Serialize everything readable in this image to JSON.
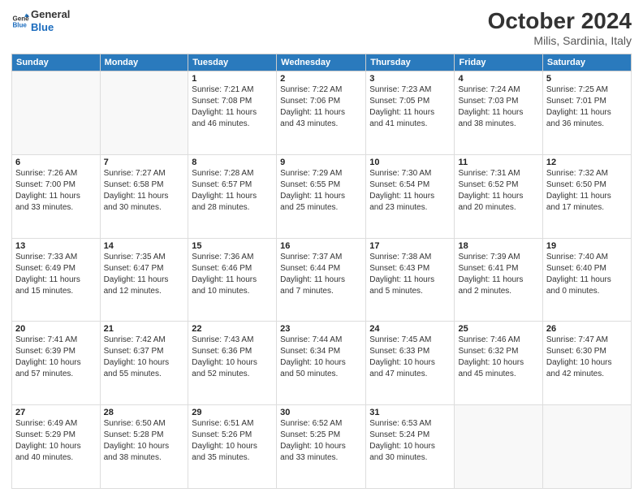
{
  "header": {
    "logo_line1": "General",
    "logo_line2": "Blue",
    "title": "October 2024",
    "subtitle": "Milis, Sardinia, Italy"
  },
  "weekdays": [
    "Sunday",
    "Monday",
    "Tuesday",
    "Wednesday",
    "Thursday",
    "Friday",
    "Saturday"
  ],
  "weeks": [
    [
      {
        "day": "",
        "info": ""
      },
      {
        "day": "",
        "info": ""
      },
      {
        "day": "1",
        "info": "Sunrise: 7:21 AM\nSunset: 7:08 PM\nDaylight: 11 hours\nand 46 minutes."
      },
      {
        "day": "2",
        "info": "Sunrise: 7:22 AM\nSunset: 7:06 PM\nDaylight: 11 hours\nand 43 minutes."
      },
      {
        "day": "3",
        "info": "Sunrise: 7:23 AM\nSunset: 7:05 PM\nDaylight: 11 hours\nand 41 minutes."
      },
      {
        "day": "4",
        "info": "Sunrise: 7:24 AM\nSunset: 7:03 PM\nDaylight: 11 hours\nand 38 minutes."
      },
      {
        "day": "5",
        "info": "Sunrise: 7:25 AM\nSunset: 7:01 PM\nDaylight: 11 hours\nand 36 minutes."
      }
    ],
    [
      {
        "day": "6",
        "info": "Sunrise: 7:26 AM\nSunset: 7:00 PM\nDaylight: 11 hours\nand 33 minutes."
      },
      {
        "day": "7",
        "info": "Sunrise: 7:27 AM\nSunset: 6:58 PM\nDaylight: 11 hours\nand 30 minutes."
      },
      {
        "day": "8",
        "info": "Sunrise: 7:28 AM\nSunset: 6:57 PM\nDaylight: 11 hours\nand 28 minutes."
      },
      {
        "day": "9",
        "info": "Sunrise: 7:29 AM\nSunset: 6:55 PM\nDaylight: 11 hours\nand 25 minutes."
      },
      {
        "day": "10",
        "info": "Sunrise: 7:30 AM\nSunset: 6:54 PM\nDaylight: 11 hours\nand 23 minutes."
      },
      {
        "day": "11",
        "info": "Sunrise: 7:31 AM\nSunset: 6:52 PM\nDaylight: 11 hours\nand 20 minutes."
      },
      {
        "day": "12",
        "info": "Sunrise: 7:32 AM\nSunset: 6:50 PM\nDaylight: 11 hours\nand 17 minutes."
      }
    ],
    [
      {
        "day": "13",
        "info": "Sunrise: 7:33 AM\nSunset: 6:49 PM\nDaylight: 11 hours\nand 15 minutes."
      },
      {
        "day": "14",
        "info": "Sunrise: 7:35 AM\nSunset: 6:47 PM\nDaylight: 11 hours\nand 12 minutes."
      },
      {
        "day": "15",
        "info": "Sunrise: 7:36 AM\nSunset: 6:46 PM\nDaylight: 11 hours\nand 10 minutes."
      },
      {
        "day": "16",
        "info": "Sunrise: 7:37 AM\nSunset: 6:44 PM\nDaylight: 11 hours\nand 7 minutes."
      },
      {
        "day": "17",
        "info": "Sunrise: 7:38 AM\nSunset: 6:43 PM\nDaylight: 11 hours\nand 5 minutes."
      },
      {
        "day": "18",
        "info": "Sunrise: 7:39 AM\nSunset: 6:41 PM\nDaylight: 11 hours\nand 2 minutes."
      },
      {
        "day": "19",
        "info": "Sunrise: 7:40 AM\nSunset: 6:40 PM\nDaylight: 11 hours\nand 0 minutes."
      }
    ],
    [
      {
        "day": "20",
        "info": "Sunrise: 7:41 AM\nSunset: 6:39 PM\nDaylight: 10 hours\nand 57 minutes."
      },
      {
        "day": "21",
        "info": "Sunrise: 7:42 AM\nSunset: 6:37 PM\nDaylight: 10 hours\nand 55 minutes."
      },
      {
        "day": "22",
        "info": "Sunrise: 7:43 AM\nSunset: 6:36 PM\nDaylight: 10 hours\nand 52 minutes."
      },
      {
        "day": "23",
        "info": "Sunrise: 7:44 AM\nSunset: 6:34 PM\nDaylight: 10 hours\nand 50 minutes."
      },
      {
        "day": "24",
        "info": "Sunrise: 7:45 AM\nSunset: 6:33 PM\nDaylight: 10 hours\nand 47 minutes."
      },
      {
        "day": "25",
        "info": "Sunrise: 7:46 AM\nSunset: 6:32 PM\nDaylight: 10 hours\nand 45 minutes."
      },
      {
        "day": "26",
        "info": "Sunrise: 7:47 AM\nSunset: 6:30 PM\nDaylight: 10 hours\nand 42 minutes."
      }
    ],
    [
      {
        "day": "27",
        "info": "Sunrise: 6:49 AM\nSunset: 5:29 PM\nDaylight: 10 hours\nand 40 minutes."
      },
      {
        "day": "28",
        "info": "Sunrise: 6:50 AM\nSunset: 5:28 PM\nDaylight: 10 hours\nand 38 minutes."
      },
      {
        "day": "29",
        "info": "Sunrise: 6:51 AM\nSunset: 5:26 PM\nDaylight: 10 hours\nand 35 minutes."
      },
      {
        "day": "30",
        "info": "Sunrise: 6:52 AM\nSunset: 5:25 PM\nDaylight: 10 hours\nand 33 minutes."
      },
      {
        "day": "31",
        "info": "Sunrise: 6:53 AM\nSunset: 5:24 PM\nDaylight: 10 hours\nand 30 minutes."
      },
      {
        "day": "",
        "info": ""
      },
      {
        "day": "",
        "info": ""
      }
    ]
  ]
}
